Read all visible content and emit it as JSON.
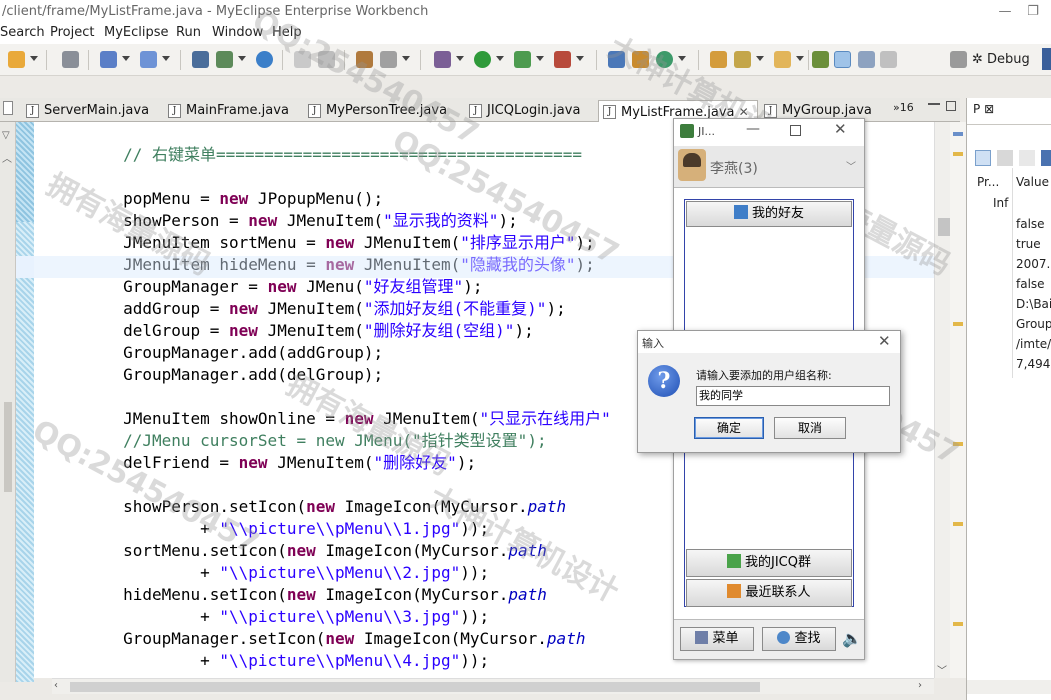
{
  "window": {
    "title": "/client/frame/MyListFrame.java - MyEclipse Enterprise Workbench"
  },
  "menus": [
    "Search",
    "Project",
    "MyEclipse",
    "Run",
    "Window",
    "Help"
  ],
  "perspective": {
    "debug_label": "Debug"
  },
  "tabs": [
    {
      "label": "ServerMain.java"
    },
    {
      "label": "MainFrame.java"
    },
    {
      "label": "MyPersonTree.java"
    },
    {
      "label": "JICQLogin.java"
    },
    {
      "label": "MyListFrame.java"
    },
    {
      "label": "MyGroup.java"
    }
  ],
  "tab_overflow": "»16",
  "code": [
    {
      "cls": "cm",
      "text": "        // 右键菜单======================================"
    },
    {
      "cls": "",
      "text": ""
    },
    {
      "segs": [
        [
          "",
          "        popMenu = "
        ],
        [
          "kw",
          "new"
        ],
        [
          "",
          " JPopupMenu();"
        ]
      ]
    },
    {
      "segs": [
        [
          "",
          "        showPerson = "
        ],
        [
          "kw",
          "new"
        ],
        [
          "",
          " JMenuItem("
        ],
        [
          "st",
          "\"显示我的资料\""
        ],
        [
          "",
          ");"
        ]
      ]
    },
    {
      "segs": [
        [
          "",
          "        JMenuItem sortMenu = "
        ],
        [
          "kw",
          "new"
        ],
        [
          "",
          " JMenuItem("
        ],
        [
          "st",
          "\"排序显示用户\""
        ],
        [
          "",
          ");"
        ]
      ]
    },
    {
      "segs": [
        [
          "",
          "        JMenuItem hideMenu = "
        ],
        [
          "kw",
          "new"
        ],
        [
          "",
          " JMenuItem("
        ],
        [
          "st",
          "\"隐藏我的头像\""
        ],
        [
          "",
          ");"
        ]
      ]
    },
    {
      "segs": [
        [
          "",
          "        GroupManager = "
        ],
        [
          "kw",
          "new"
        ],
        [
          "",
          " JMenu("
        ],
        [
          "st",
          "\"好友组管理\""
        ],
        [
          "",
          ");"
        ]
      ]
    },
    {
      "segs": [
        [
          "",
          "        addGroup = "
        ],
        [
          "kw",
          "new"
        ],
        [
          "",
          " JMenuItem("
        ],
        [
          "st",
          "\"添加好友组(不能重复)\""
        ],
        [
          "",
          ");"
        ]
      ]
    },
    {
      "segs": [
        [
          "",
          "        delGroup = "
        ],
        [
          "kw",
          "new"
        ],
        [
          "",
          " JMenuItem("
        ],
        [
          "st",
          "\"删除好友组(空组)\""
        ],
        [
          "",
          ");"
        ]
      ]
    },
    {
      "segs": [
        [
          "",
          "        GroupManager.add(addGroup);"
        ]
      ]
    },
    {
      "segs": [
        [
          "",
          "        GroupManager.add(delGroup);"
        ]
      ]
    },
    {
      "cls": "",
      "text": ""
    },
    {
      "segs": [
        [
          "",
          "        JMenuItem showOnline = "
        ],
        [
          "kw",
          "new"
        ],
        [
          "",
          " JMenuItem("
        ],
        [
          "st",
          "\"只显示在线用户\""
        ]
      ]
    },
    {
      "cls": "cm",
      "text": "        //JMenu cursorSet = new JMenu(\"指针类型设置\");"
    },
    {
      "segs": [
        [
          "",
          "        delFriend = "
        ],
        [
          "kw",
          "new"
        ],
        [
          "",
          " JMenuItem("
        ],
        [
          "st",
          "\"删除好友\""
        ],
        [
          "",
          ");"
        ]
      ]
    },
    {
      "cls": "",
      "text": ""
    },
    {
      "segs": [
        [
          "",
          "        showPerson.setIcon("
        ],
        [
          "kw",
          "new"
        ],
        [
          "",
          " ImageIcon(MyCursor."
        ],
        [
          "fd it",
          "path"
        ]
      ]
    },
    {
      "segs": [
        [
          "",
          "                + "
        ],
        [
          "st",
          "\"\\\\picture\\\\pMenu\\\\1.jpg\""
        ],
        [
          "",
          "));"
        ]
      ]
    },
    {
      "segs": [
        [
          "",
          "        sortMenu.setIcon("
        ],
        [
          "kw",
          "new"
        ],
        [
          "",
          " ImageIcon(MyCursor."
        ],
        [
          "fd it",
          "path"
        ]
      ]
    },
    {
      "segs": [
        [
          "",
          "                + "
        ],
        [
          "st",
          "\"\\\\picture\\\\pMenu\\\\2.jpg\""
        ],
        [
          "",
          "));"
        ]
      ]
    },
    {
      "segs": [
        [
          "",
          "        hideMenu.setIcon("
        ],
        [
          "kw",
          "new"
        ],
        [
          "",
          " ImageIcon(MyCursor."
        ],
        [
          "fd it",
          "path"
        ]
      ]
    },
    {
      "segs": [
        [
          "",
          "                + "
        ],
        [
          "st",
          "\"\\\\picture\\\\pMenu\\\\3.jpg\""
        ],
        [
          "",
          "));"
        ]
      ]
    },
    {
      "segs": [
        [
          "",
          "        GroupManager.setIcon("
        ],
        [
          "kw",
          "new"
        ],
        [
          "",
          " ImageIcon(MyCursor."
        ],
        [
          "fd it",
          "path"
        ]
      ]
    },
    {
      "segs": [
        [
          "",
          "                + "
        ],
        [
          "st",
          "\"\\\\picture\\\\pMenu\\\\4.jpg\""
        ],
        [
          "",
          "));"
        ]
      ]
    }
  ],
  "properties": {
    "tab_label": "P",
    "col_property": "Pr...",
    "col_value": "Value",
    "row_label": "Inf",
    "values": [
      "false",
      "true",
      "2007...",
      "false",
      "D:\\Bai",
      "Group",
      "/imte/",
      "7,494"
    ]
  },
  "jicq": {
    "title": "JI...",
    "user": "李燕(3)",
    "friends_btn": "我的好友",
    "group_btn": "我的JICQ群",
    "recent_btn": "最近联系人",
    "menu_btn": "菜单",
    "find_btn": "查找"
  },
  "dialog": {
    "title": "输入",
    "prompt": "请输入要添加的用户组名称:",
    "value": "我的同学",
    "ok": "确定",
    "cancel": "取消"
  },
  "watermarks": [
    "QQ:254540457",
    "拥有海量源码",
    "大神计算机设计"
  ]
}
